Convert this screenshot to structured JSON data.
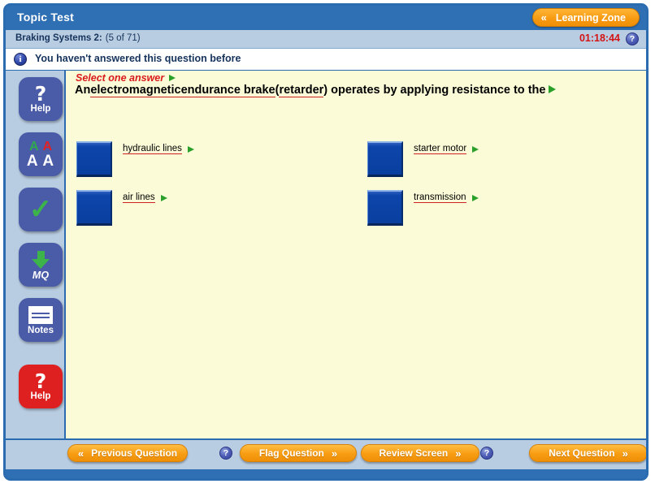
{
  "window": {
    "title": "Topic Test",
    "learning_zone_button": "Learning Zone",
    "chevron_left": "«"
  },
  "subheader": {
    "topic": "Braking Systems 2:",
    "progress": "(5 of 71)",
    "timer": "01:18:44",
    "help_icon_label": "?"
  },
  "infobar": {
    "icon_label": "i",
    "message": "You haven't answered this question before"
  },
  "sidebar": {
    "items": [
      {
        "name": "help-blue",
        "glyph": "?",
        "label": "Help"
      },
      {
        "name": "text-size",
        "a_green": "A",
        "a_red": "A",
        "a_white": "A A"
      },
      {
        "name": "check-answer",
        "glyph": "✓"
      },
      {
        "name": "mark-question",
        "label": "MQ"
      },
      {
        "name": "notes",
        "label": "Notes"
      },
      {
        "name": "help-red",
        "glyph": "?",
        "label": "Help"
      }
    ]
  },
  "question": {
    "instruction": "Select one answer",
    "text_parts": [
      {
        "text": "An ",
        "underline": false
      },
      {
        "text": "electromagnetic",
        "underline": true
      },
      {
        "text": " ",
        "underline": false
      },
      {
        "text": "endurance brake",
        "underline": true
      },
      {
        "text": " (",
        "underline": false
      },
      {
        "text": "retarder",
        "underline": true
      },
      {
        "text": ") operates by applying resistance to the ",
        "underline": false
      }
    ],
    "full_text": "An electromagnetic endurance brake (retarder) operates by applying resistance to the"
  },
  "answers": [
    {
      "label": "hydraulic lines",
      "selected": false,
      "column": "left",
      "row": 0
    },
    {
      "label": "air lines",
      "selected": false,
      "column": "left",
      "row": 1
    },
    {
      "label": "starter motor",
      "selected": false,
      "column": "right",
      "row": 0
    },
    {
      "label": "transmission",
      "selected": false,
      "column": "right",
      "row": 1
    }
  ],
  "nav": {
    "previous": "Previous Question",
    "flag": "Flag Question",
    "review": "Review Screen",
    "next": "Next Question",
    "chevron_left": "«",
    "chevron_right": "»",
    "help_icon_label": "?"
  },
  "colors": {
    "frame_blue": "#2f6fb3",
    "panel_blue": "#b9cde2",
    "content_yellow": "#fbfbd7",
    "accent_orange": "#f89e14",
    "timer_red": "#d31414",
    "underline_red": "#cc2222",
    "arrow_green": "#2aa02a",
    "option_blue": "#0a3f9e"
  }
}
